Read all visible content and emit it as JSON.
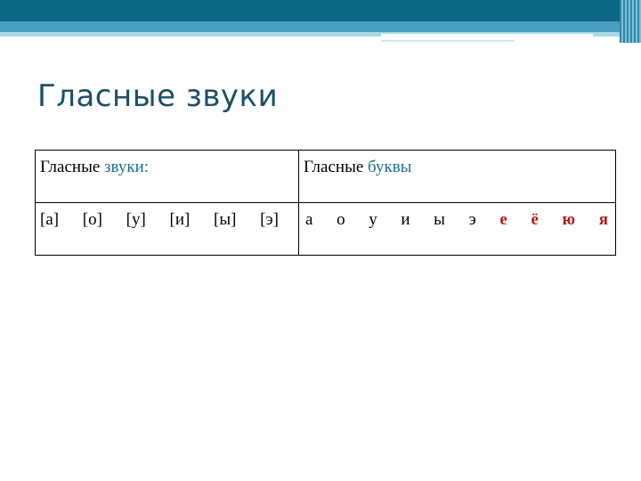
{
  "slide": {
    "title": "Гласные звуки"
  },
  "table": {
    "col1_header": {
      "plain": "Гласные ",
      "highlight": "звуки:"
    },
    "col2_header": {
      "plain": "Гласные ",
      "highlight": "буквы"
    },
    "sounds": [
      "[а]",
      "[о]",
      "[у]",
      "[и]",
      "[ы]",
      "[э]"
    ],
    "letters_plain": [
      "а",
      "о",
      "у",
      "и",
      "ы",
      "э"
    ],
    "letters_red": [
      "е",
      "ё",
      "ю",
      "я"
    ]
  },
  "colors": {
    "theme_dark": "#0e6685",
    "theme_mid": "#4a9fc0",
    "title_text": "#1b4f68",
    "highlight_text": "#1e6f8e",
    "red_letters": "#b01b1b"
  }
}
